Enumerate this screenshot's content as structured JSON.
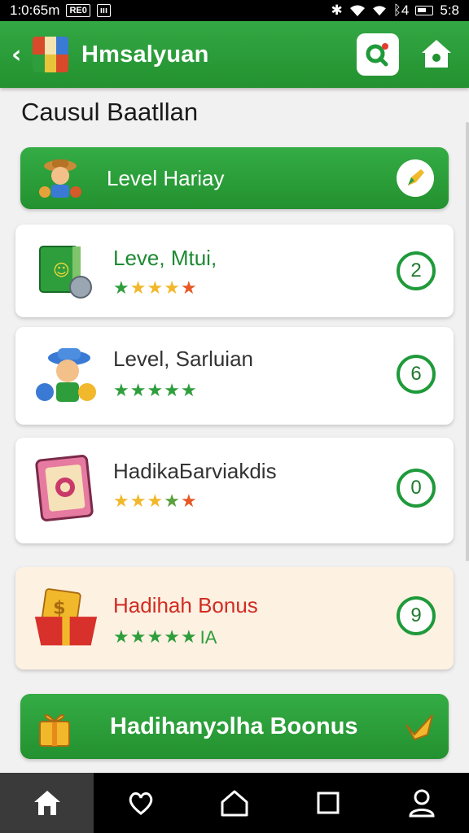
{
  "status_bar": {
    "time": "1:0:65m",
    "badge_1": "RE0",
    "badge_2": "ııı",
    "battery": "5:8",
    "signal_text": "ᛒ4"
  },
  "app_bar": {
    "title": "Hmsalyuan"
  },
  "section": {
    "title": "Causul Baatllan"
  },
  "level_banner": {
    "label": "Level Hariay"
  },
  "cards": [
    {
      "title": "Leve, Mtui,",
      "count": "2",
      "stars": [
        "★",
        "★",
        "★",
        "★",
        "★"
      ],
      "star_colors": [
        "#2e9e3c",
        "#f2b82b",
        "#f2b82b",
        "#f2b82b",
        "#e85826"
      ]
    },
    {
      "title": "Level, Sarluian",
      "count": "6",
      "stars": [
        "★",
        "★",
        "★",
        "★",
        "★"
      ],
      "star_colors": [
        "#2e9e3c",
        "#2e9e3c",
        "#2e9e3c",
        "#2e9e3c",
        "#2e9e3c"
      ]
    },
    {
      "title": "HadikaБarviakdis",
      "count": "0",
      "stars": [
        "★",
        "★",
        "★",
        "★",
        "★"
      ],
      "star_colors": [
        "#f2b82b",
        "#f2b82b",
        "#f2b82b",
        "#5aa03c",
        "#e85826"
      ]
    },
    {
      "title": "Hadihah Bonus",
      "count": "9",
      "stars": [
        "★",
        "★",
        "★",
        "★",
        "★"
      ],
      "star_colors": [
        "#2e9e3c",
        "#2e9e3c",
        "#2e9e3c",
        "#2e9e3c",
        "#2e9e3c"
      ],
      "extra": "IA"
    }
  ],
  "bonus_banner": {
    "label": "Hadihanyɔlha Boonus"
  },
  "bottom_nav": {
    "items": [
      "home-icon",
      "heart-icon",
      "house-outline-icon",
      "square-icon",
      "profile-icon"
    ],
    "active": 0
  },
  "colors": {
    "primary_green": "#23912f",
    "bonus_card_bg": "#fdf1e2",
    "bonus_title": "#d22c22"
  }
}
